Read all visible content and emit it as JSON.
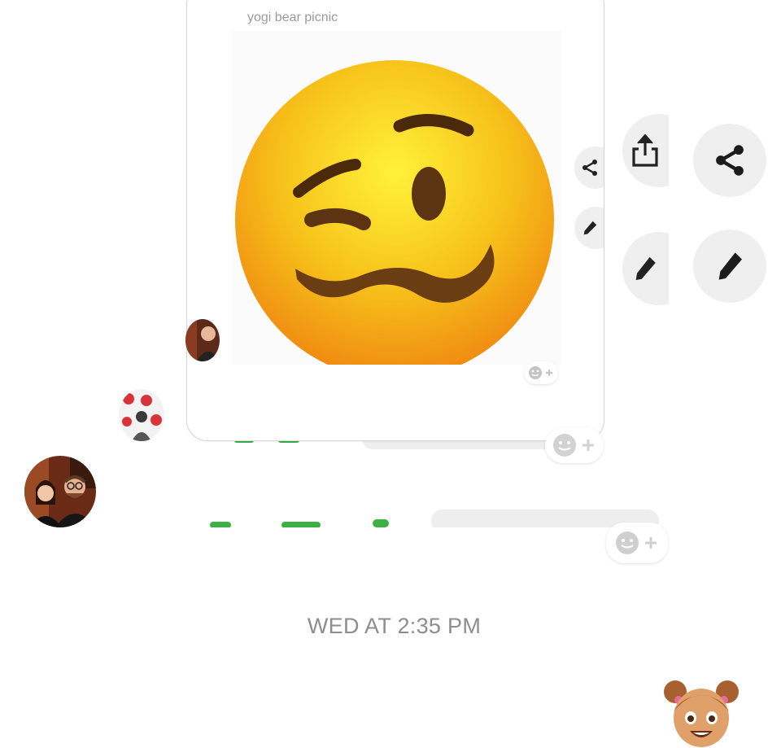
{
  "message": {
    "caption": "yogi bear picnic",
    "image_icon": "woozy-face-emoji"
  },
  "actions": {
    "share_icon": "share-icon",
    "edit_icon": "pencil-icon",
    "upload_icon": "upload-share-icon"
  },
  "reaction_icon": "add-reaction-icon",
  "timestamp": "WED AT 2:35 PM",
  "colors": {
    "emoji_yellow": "#f7c21a",
    "emoji_orange": "#f39a14",
    "feature_brown": "#6b3d12",
    "timestamp_gray": "#8d8d8d",
    "green": "#3cb043"
  }
}
